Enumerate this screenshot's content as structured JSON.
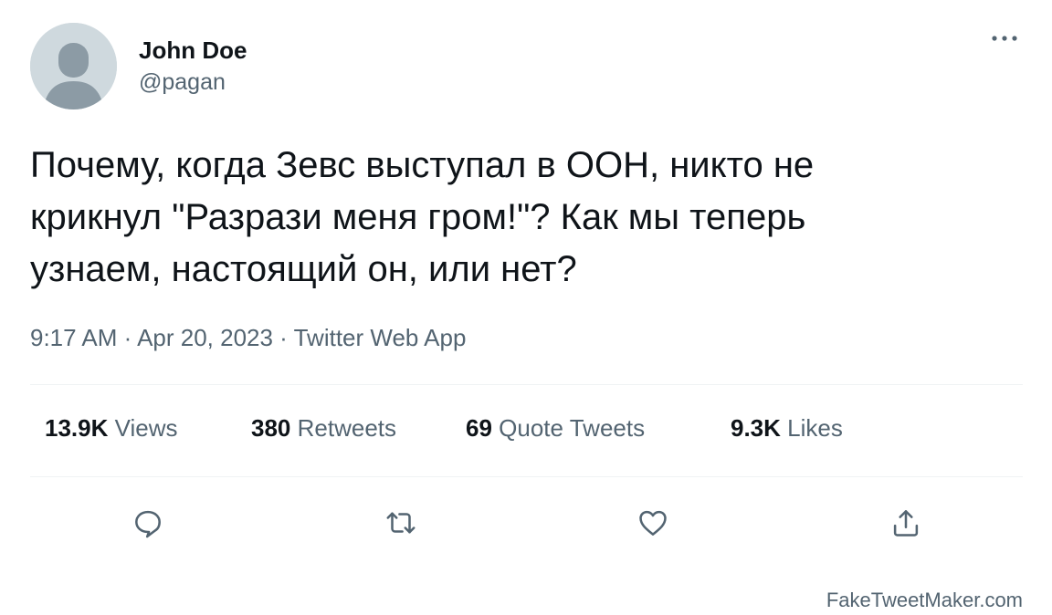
{
  "author": {
    "name": "John Doe",
    "handle": "@pagan"
  },
  "tweet": {
    "text": "Почему, когда Зевс выступал в ООН, никто не\nкрикнул \"Разрази меня гром!\"? Как мы теперь\nузнаем, настоящий он, или нет?",
    "meta": "9:17 AM · Apr 20, 2023 · Twitter Web App"
  },
  "stats": {
    "views": {
      "count": "13.9K",
      "label": "Views"
    },
    "retweets": {
      "count": "380",
      "label": "Retweets"
    },
    "quotes": {
      "count": "69",
      "label": "Quote Tweets"
    },
    "likes": {
      "count": "9.3K",
      "label": "Likes"
    }
  },
  "actions": [
    "reply-icon",
    "retweet-icon",
    "like-icon",
    "share-icon"
  ],
  "watermark": "FakeTweetMaker.com",
  "colors": {
    "text_primary": "#0f1419",
    "text_secondary": "#536471",
    "icon": "#536471",
    "divider": "#eff3f4",
    "avatar_bg": "#cfd9de",
    "avatar_figure": "#8c9ba5"
  }
}
